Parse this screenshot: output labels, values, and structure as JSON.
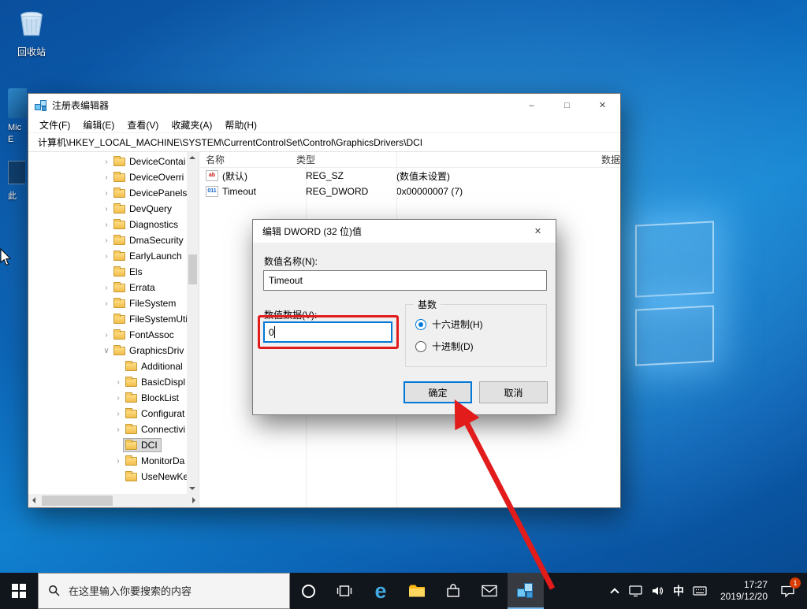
{
  "colors": {
    "accent": "#0078d7",
    "annotation": "#e21b1b",
    "taskbar": "#11151c"
  },
  "desktop": {
    "recycle_bin_label": "回收站",
    "edge_label_line1": "Mic",
    "edge_label_line2": "E",
    "thispc_label": "此"
  },
  "regedit": {
    "title": "注册表编辑器",
    "caption": {
      "minimize": "–",
      "maximize": "□",
      "close": "✕"
    },
    "menus": [
      {
        "label": "文件(F)"
      },
      {
        "label": "编辑(E)"
      },
      {
        "label": "查看(V)"
      },
      {
        "label": "收藏夹(A)"
      },
      {
        "label": "帮助(H)"
      }
    ],
    "address": "计算机\\HKEY_LOCAL_MACHINE\\SYSTEM\\CurrentControlSet\\Control\\GraphicsDrivers\\DCI",
    "tree": [
      {
        "chevron": "›",
        "label": "DeviceContai",
        "class": "d0"
      },
      {
        "chevron": "›",
        "label": "DeviceOverri",
        "class": "d0"
      },
      {
        "chevron": "›",
        "label": "DevicePanels",
        "class": "d0"
      },
      {
        "chevron": "›",
        "label": "DevQuery",
        "class": "d0"
      },
      {
        "chevron": "›",
        "label": "Diagnostics",
        "class": "d0"
      },
      {
        "chevron": "›",
        "label": "DmaSecurity",
        "class": "d0"
      },
      {
        "chevron": "›",
        "label": "EarlyLaunch",
        "class": "d0"
      },
      {
        "chevron": "",
        "label": "Els",
        "class": "d0"
      },
      {
        "chevron": "›",
        "label": "Errata",
        "class": "d0"
      },
      {
        "chevron": "›",
        "label": "FileSystem",
        "class": "d0"
      },
      {
        "chevron": "",
        "label": "FileSystemUti",
        "class": "d0"
      },
      {
        "chevron": "›",
        "label": "FontAssoc",
        "class": "d0"
      },
      {
        "chevron": "∨",
        "label": "GraphicsDriv",
        "class": "d0"
      },
      {
        "chevron": "",
        "label": "Additional",
        "class": "d1"
      },
      {
        "chevron": "›",
        "label": "BasicDispl",
        "class": "d1"
      },
      {
        "chevron": "›",
        "label": "BlockList",
        "class": "d1"
      },
      {
        "chevron": "›",
        "label": "Configurat",
        "class": "d1"
      },
      {
        "chevron": "›",
        "label": "Connectivi",
        "class": "d1"
      },
      {
        "chevron": "",
        "label": "DCI",
        "class": "d1 selected"
      },
      {
        "chevron": "›",
        "label": "MonitorDa",
        "class": "d1"
      },
      {
        "chevron": "",
        "label": "UseNewKe",
        "class": "d1"
      }
    ],
    "columns": [
      {
        "label": "名称"
      },
      {
        "label": "类型"
      },
      {
        "label": "数据"
      }
    ],
    "rows": [
      {
        "icon": "ab",
        "name": "(默认)",
        "type": "REG_SZ",
        "data": "(数值未设置)",
        "class": "row-sz"
      },
      {
        "icon": "011",
        "name": "Timeout",
        "type": "REG_DWORD",
        "data": "0x00000007 (7)",
        "class": "row-dword"
      }
    ]
  },
  "dialog": {
    "title": "编辑 DWORD (32 位)值",
    "close": "✕",
    "value_name_label": "数值名称(N):",
    "value_name": "Timeout",
    "value_data_label": "数值数据(V):",
    "value_data": "0",
    "base_label": "基数",
    "hex_option": "十六进制(H)",
    "dec_option": "十进制(D)",
    "ok": "确定",
    "cancel": "取消"
  },
  "taskbar": {
    "search_placeholder": "在这里输入你要搜索的内容",
    "edge_glyph": "e",
    "ime": "中",
    "time": "17:27",
    "date": "2019/12/20",
    "notification_badge": "1"
  }
}
